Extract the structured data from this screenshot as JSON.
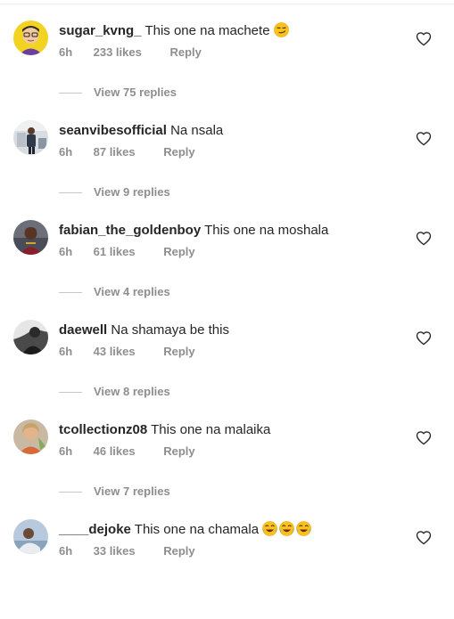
{
  "comments": [
    {
      "username": "sugar_kvng_",
      "text": "This one na machete",
      "emoji": "😏",
      "time": "6h",
      "likes": "233 likes",
      "reply": "Reply",
      "view_replies": "View 75 replies",
      "avatar": "cartoon-avatar"
    },
    {
      "username": "seanvibesofficial",
      "text": "Na nsala",
      "time": "6h",
      "likes": "87 likes",
      "reply": "Reply",
      "view_replies": "View 9 replies",
      "avatar": "photo-avatar"
    },
    {
      "username": "fabian_the_goldenboy",
      "text": "This one na moshala",
      "time": "6h",
      "likes": "61 likes",
      "reply": "Reply",
      "view_replies": "View 4 replies",
      "avatar": "photo-avatar"
    },
    {
      "username": "daewell",
      "text": "Na shamaya be this",
      "time": "6h",
      "likes": "43 likes",
      "reply": "Reply",
      "view_replies": "View 8 replies",
      "avatar": "photo-avatar"
    },
    {
      "username": "tcollectionz08",
      "text": "This one na malaika",
      "time": "6h",
      "likes": "46 likes",
      "reply": "Reply",
      "view_replies": "View 7 replies",
      "avatar": "photo-avatar"
    },
    {
      "username": "____dejoke",
      "text": "This one na chamala",
      "emoji": "😂😂😂",
      "time": "6h",
      "likes": "33 likes",
      "reply": "Reply",
      "avatar": "photo-avatar"
    }
  ],
  "colors": {
    "primary_text": "#262626",
    "secondary_text": "#8e8e8e",
    "divider": "#c7c7c7"
  },
  "icons": {
    "like": "heart-outline-icon",
    "smirk": "smirking-face-emoji",
    "laugh": "tears-of-joy-emoji"
  }
}
